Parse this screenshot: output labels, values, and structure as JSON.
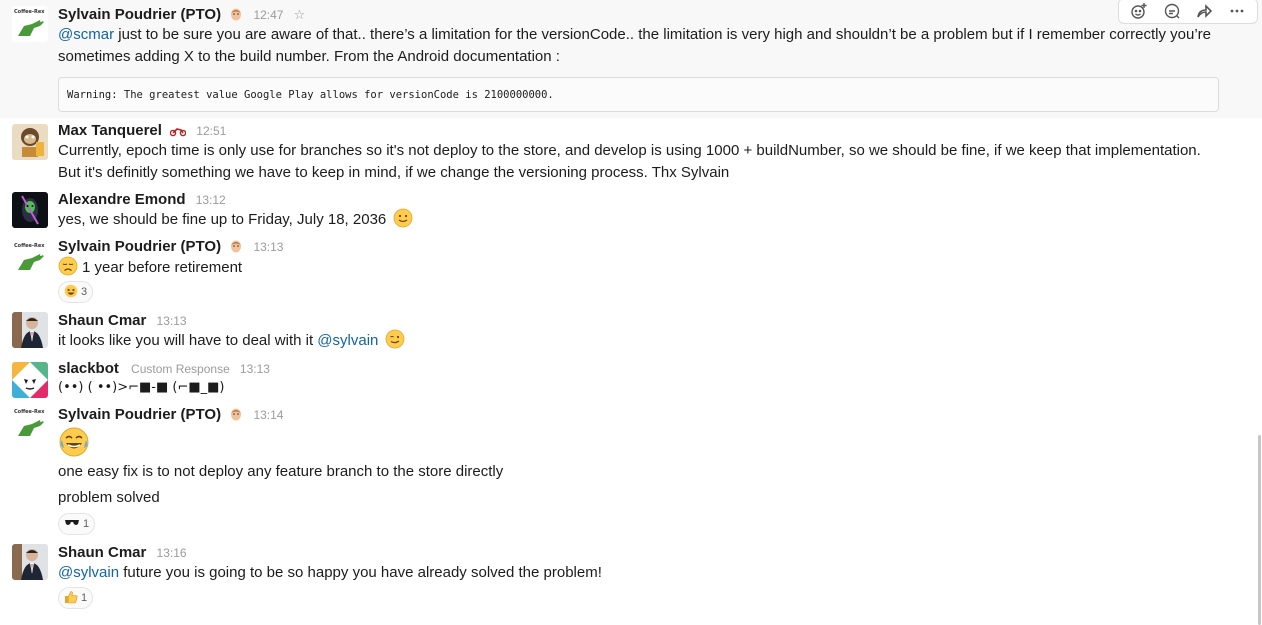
{
  "messages": [
    {
      "author": "Sylvain Poudrier (PTO)",
      "time": "12:47",
      "mention": "@scmar",
      "text1": " just to be sure you are aware of that.. there’s a limitation for the versionCode.. the limitation is very high and shouldn’t be a problem but if I remember correctly you’re",
      "text2": "sometimes adding X to the build number. From the Android documentation :",
      "code": "Warning: The greatest value Google Play allows for versionCode is 2100000000."
    },
    {
      "author": "Max Tanquerel",
      "time": "12:51",
      "text1": "Currently, epoch time is only use for branches so it's not deploy to the store, and develop is using 1000 + buildNumber, so we should be fine, if we keep that implementation.",
      "text2": "But it's definitly something we have to keep in mind, if we change the versioning process. Thx Sylvain"
    },
    {
      "author": "Alexandre Emond",
      "time": "13:12",
      "text1": "yes, we should be fine up to  Friday, July 18, 2036"
    },
    {
      "author": "Sylvain Poudrier (PTO)",
      "time": "13:13",
      "text1": "1 year before retirement",
      "reaction_count": "3"
    },
    {
      "author": "Shaun Cmar",
      "time": "13:13",
      "text1": "it looks like you will have to deal with it ",
      "mention": "@sylvain"
    },
    {
      "author": "slackbot",
      "subtitle": "Custom Response",
      "time": "13:13",
      "text1": "(••)  ( ••)>⌐■-■  (⌐■_■)"
    },
    {
      "author": "Sylvain Poudrier (PTO)",
      "time": "13:14",
      "text1": "one easy fix is to not deploy any feature branch to the store directly",
      "text2": "problem solved",
      "reaction_count": "1"
    },
    {
      "author": "Shaun Cmar",
      "time": "13:16",
      "mention": "@sylvain",
      "text1": " future you is going to be so happy you have already solved the problem!",
      "reaction_count": "1"
    }
  ],
  "actions": [
    "add-reaction-icon",
    "reply-thread-icon",
    "share-icon",
    "more-icon"
  ],
  "colors": {
    "mention": "#1264a3",
    "timestamp": "#9b9b9b",
    "hover_bg": "#f8f8f8"
  }
}
